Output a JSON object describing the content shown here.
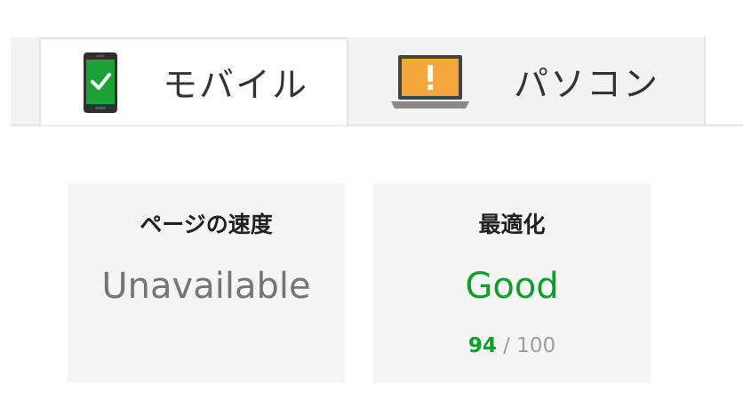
{
  "tabs": [
    {
      "label": "モバイル",
      "icon": "mobile-phone-check-icon",
      "selected": true,
      "status_color": "#1ba338"
    },
    {
      "label": "パソコン",
      "icon": "laptop-warning-icon",
      "selected": false,
      "status_color": "#f4a53c"
    }
  ],
  "cards": {
    "speed": {
      "title": "ページの速度",
      "value": "Unavailable",
      "value_color": "#757575"
    },
    "optimization": {
      "title": "最適化",
      "value": "Good",
      "value_color": "#109d2c",
      "score": "94",
      "score_max": "/ 100"
    }
  }
}
